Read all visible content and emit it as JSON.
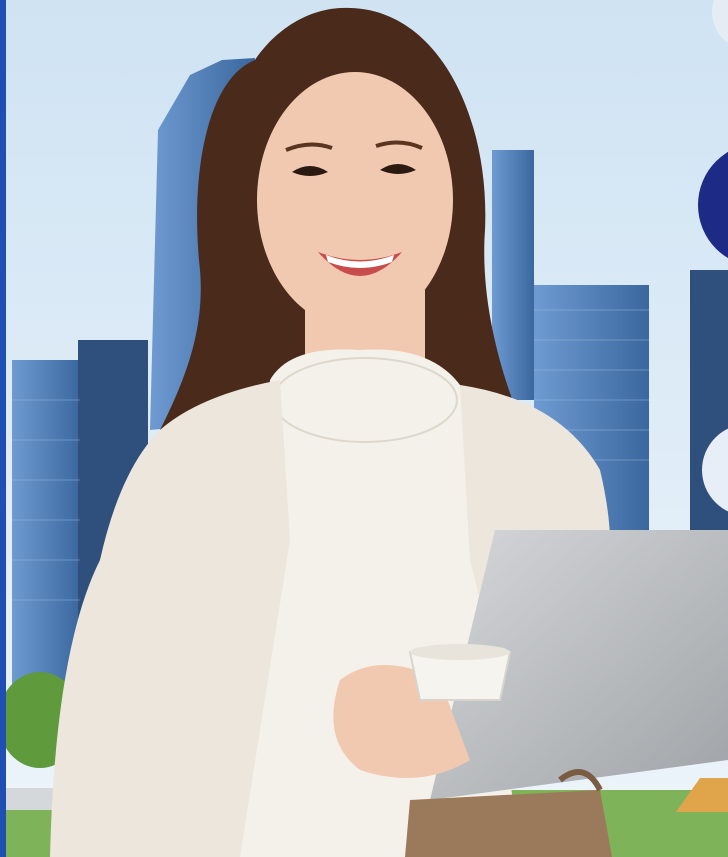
{
  "colors": {
    "sky_top": "#cfe3f3",
    "sky_bottom": "#eef5fb",
    "building_blue": "#4f7fbc",
    "building_dark": "#2f4f7c",
    "rail_blue": "#1f4fb3",
    "accent_navy": "#1d2b86",
    "grass": "#7fb35a",
    "blazer": "#ece6dc",
    "blouse": "#f4f1ea",
    "hair": "#4a2a1a",
    "skin": "#f1c9b0",
    "tablet": "#b9bcc0",
    "cup": "#f6f4ef",
    "bag": "#9b7a5c"
  },
  "scene": {
    "subject": "smiling-woman-holding-tablet-and-coffee-cup",
    "background": "city-skyscrapers-with-park"
  }
}
